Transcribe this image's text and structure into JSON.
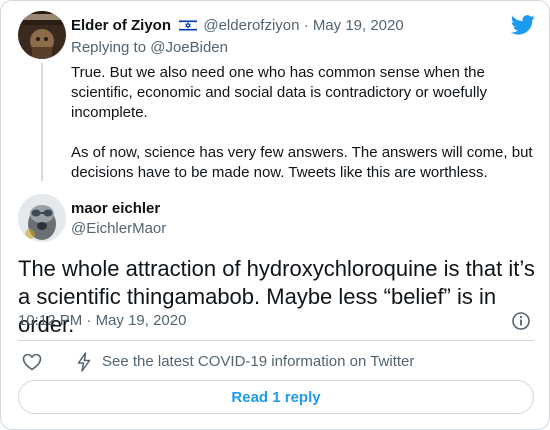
{
  "parent_tweet": {
    "author_name": "Elder of Ziyon",
    "handle": "@elderofziyon",
    "separator": "·",
    "date": "May 19, 2020",
    "replying_to_prefix": "Replying to",
    "replying_to_handle": "@JoeBiden",
    "paragraph_1": "True. But we also need one who has common sense when the scientific, economic and social data is contradictory or woefully incomplete.",
    "paragraph_2": "As of now, science has very few answers. The answers will come, but decisions have to be made now. Tweets like this are worthless."
  },
  "main_tweet": {
    "author_name": "maor eichler",
    "handle": "@EichlerMaor",
    "text": "The whole attraction of hydroxychloroquine is that it’s a scientific thingamabob. Maybe less “belief” is in order.",
    "time": "10:12 PM",
    "separator": "·",
    "date": "May 19, 2020"
  },
  "actions": {
    "covid_info": "See the latest COVID-19 information on Twitter"
  },
  "read_replies_button": "Read 1 reply",
  "colors": {
    "accent": "#1d9bf0",
    "text": "#0f1419",
    "muted": "#536471",
    "border": "#cfd9de"
  },
  "icons": [
    "twitter-bird-icon",
    "israel-flag-icon",
    "info-icon",
    "heart-icon",
    "lightning-bolt-icon"
  ]
}
